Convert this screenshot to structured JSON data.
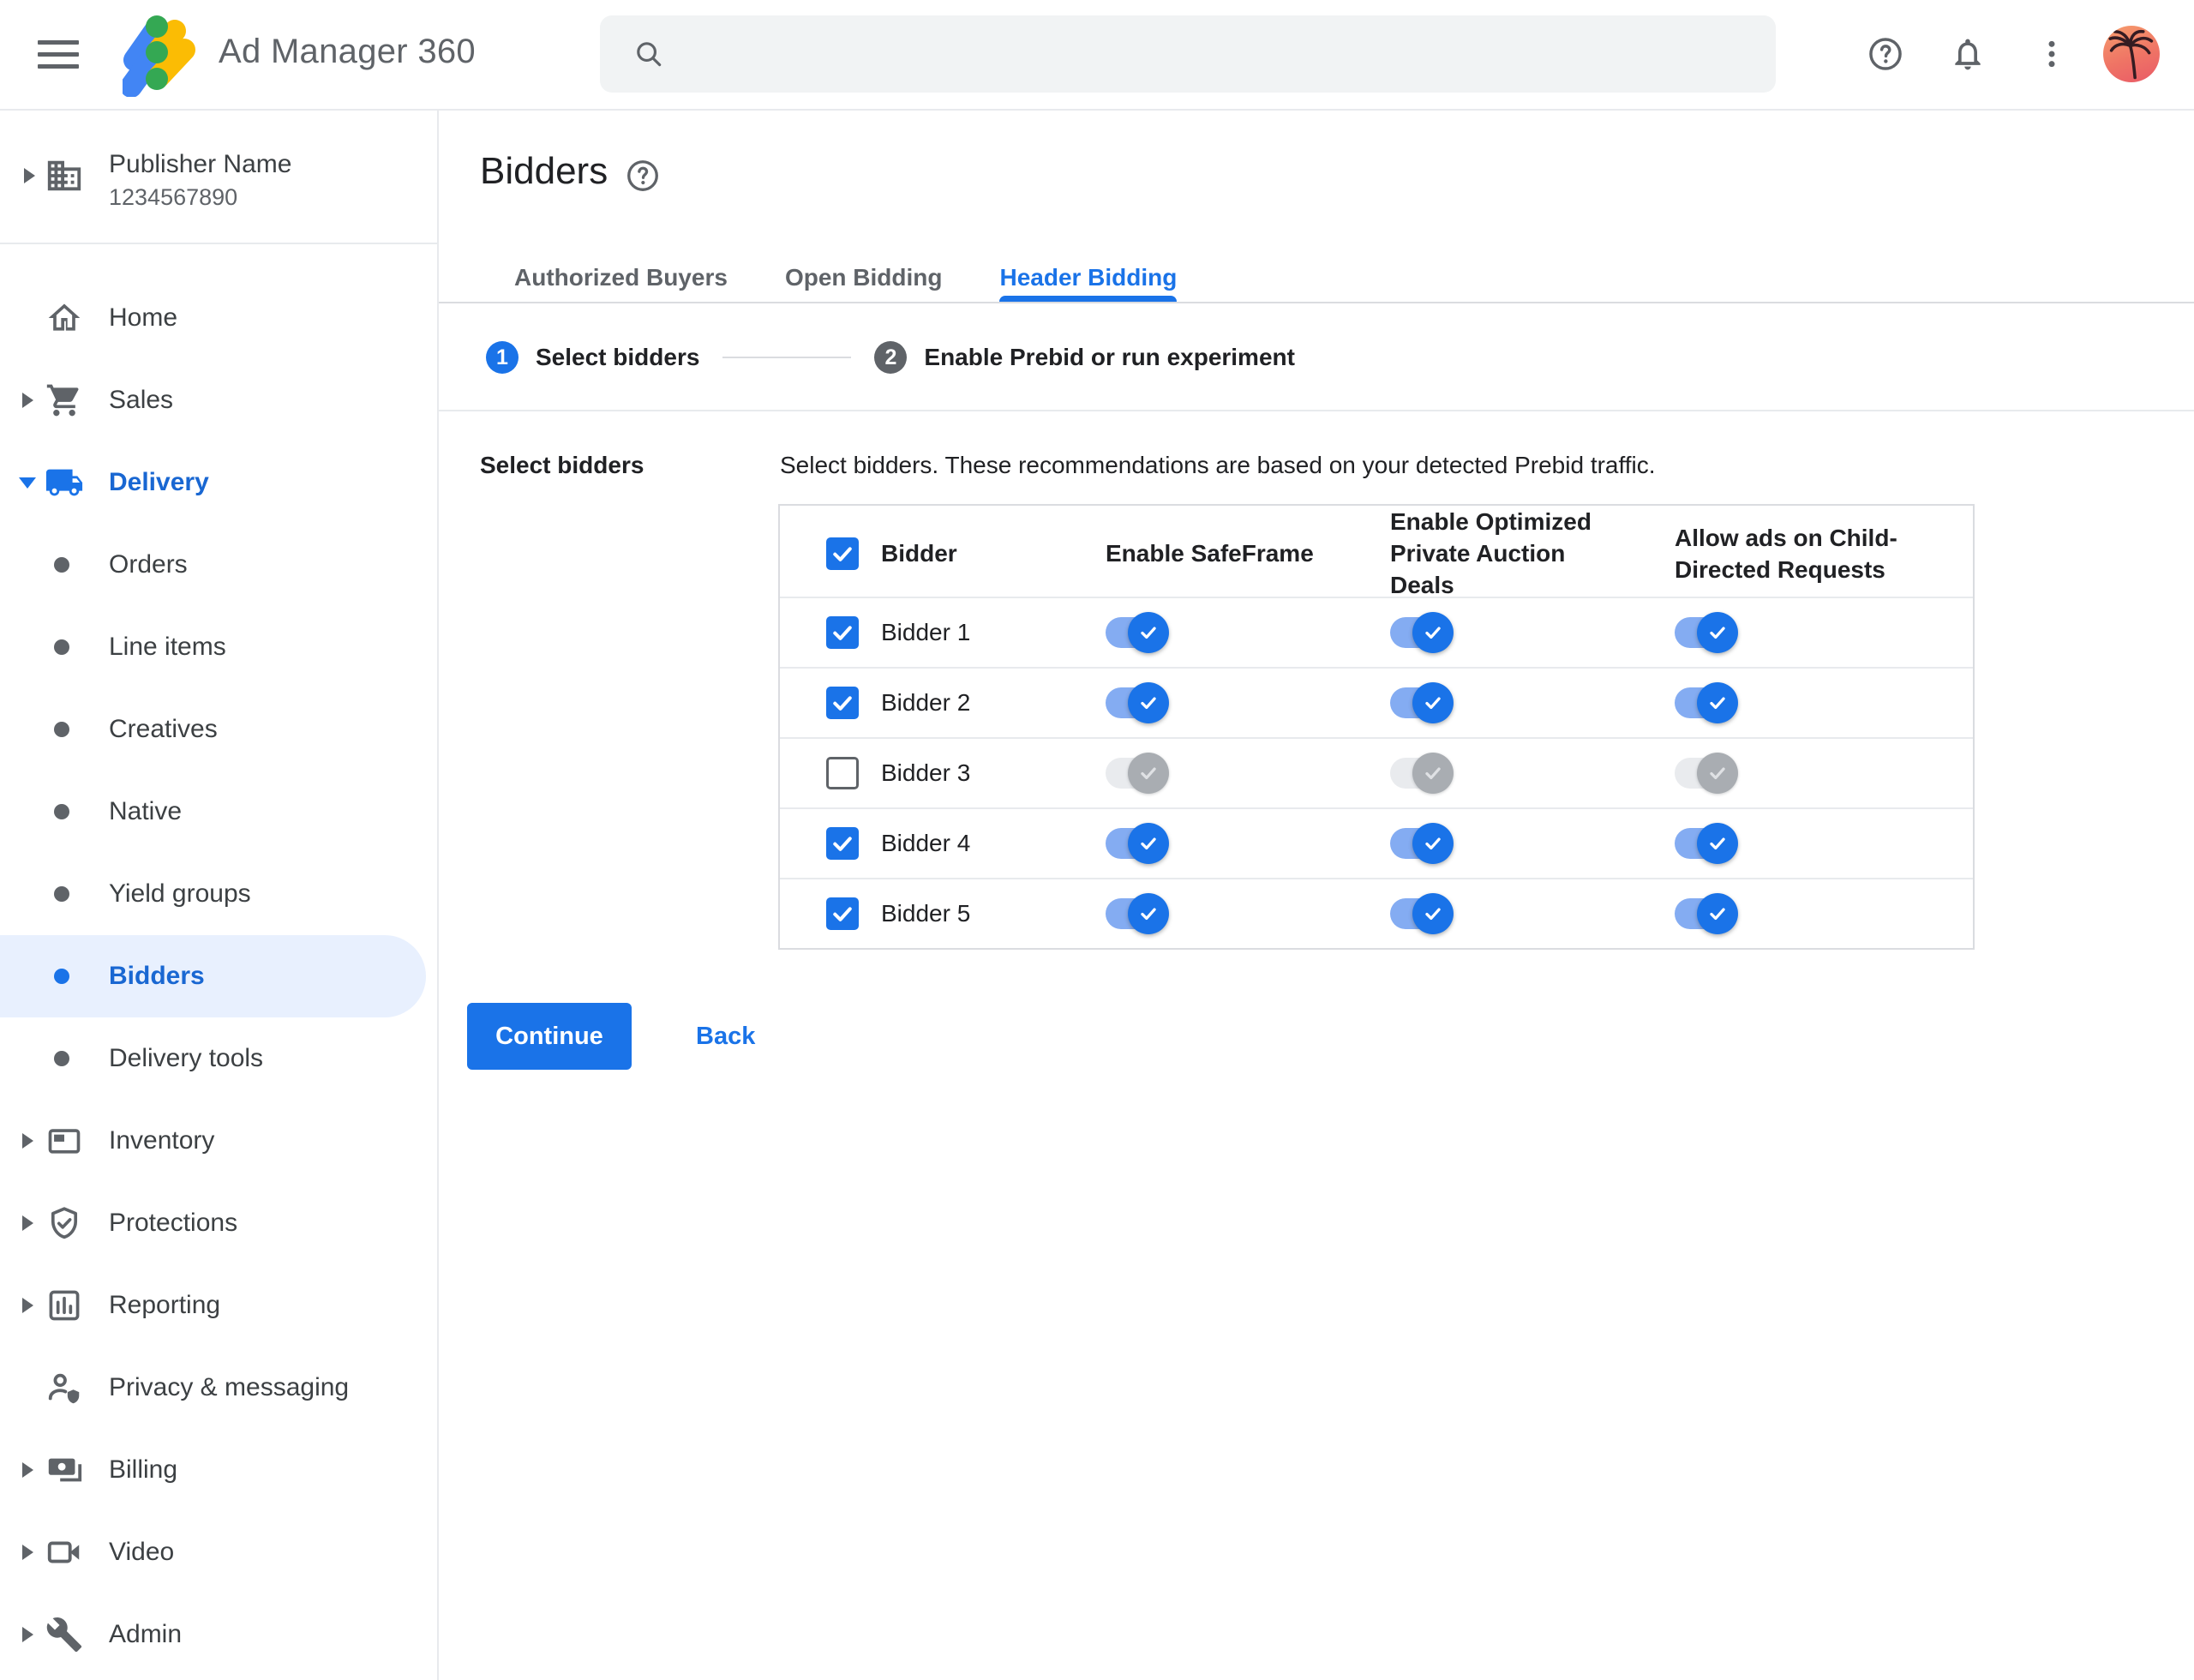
{
  "header": {
    "app_title": "Ad Manager 360",
    "search": {
      "value": "",
      "placeholder": ""
    },
    "icons": [
      "menu-icon",
      "ad-manager-logo",
      "search-icon",
      "help-icon",
      "notifications-icon",
      "more-vert-icon",
      "avatar"
    ]
  },
  "sidebar": {
    "publisher_name": "Publisher Name",
    "publisher_id": "1234567890",
    "items": [
      {
        "label": "Home",
        "icon": "home-icon",
        "level": "top",
        "expand": null,
        "active": false,
        "selected": false
      },
      {
        "label": "Sales",
        "icon": "cart-icon",
        "level": "top",
        "expand": "collapsed",
        "active": false,
        "selected": false
      },
      {
        "label": "Delivery",
        "icon": "truck-icon",
        "level": "top",
        "expand": "expanded",
        "active": true,
        "selected": false
      },
      {
        "label": "Orders",
        "icon": "bullet",
        "level": "sub",
        "expand": null,
        "active": false,
        "selected": false
      },
      {
        "label": "Line items",
        "icon": "bullet",
        "level": "sub",
        "expand": null,
        "active": false,
        "selected": false
      },
      {
        "label": "Creatives",
        "icon": "bullet",
        "level": "sub",
        "expand": null,
        "active": false,
        "selected": false
      },
      {
        "label": "Native",
        "icon": "bullet",
        "level": "sub",
        "expand": null,
        "active": false,
        "selected": false
      },
      {
        "label": "Yield groups",
        "icon": "bullet",
        "level": "sub",
        "expand": null,
        "active": false,
        "selected": false
      },
      {
        "label": "Bidders",
        "icon": "bullet",
        "level": "sub",
        "expand": null,
        "active": true,
        "selected": true
      },
      {
        "label": "Delivery tools",
        "icon": "bullet",
        "level": "sub",
        "expand": null,
        "active": false,
        "selected": false
      },
      {
        "label": "Inventory",
        "icon": "inventory-icon",
        "level": "top",
        "expand": "collapsed",
        "active": false,
        "selected": false
      },
      {
        "label": "Protections",
        "icon": "shield-check-icon",
        "level": "top",
        "expand": "collapsed",
        "active": false,
        "selected": false
      },
      {
        "label": "Reporting",
        "icon": "bar-chart-icon",
        "level": "top",
        "expand": "collapsed",
        "active": false,
        "selected": false
      },
      {
        "label": "Privacy & messaging",
        "icon": "person-shield-icon",
        "level": "top",
        "expand": null,
        "active": false,
        "selected": false
      },
      {
        "label": "Billing",
        "icon": "payments-icon",
        "level": "top",
        "expand": "collapsed",
        "active": false,
        "selected": false
      },
      {
        "label": "Video",
        "icon": "videocam-icon",
        "level": "top",
        "expand": "collapsed",
        "active": false,
        "selected": false
      },
      {
        "label": "Admin",
        "icon": "wrench-icon",
        "level": "top",
        "expand": "collapsed",
        "active": false,
        "selected": false
      }
    ]
  },
  "main": {
    "page_title": "Bidders",
    "tabs": [
      {
        "label": "Authorized Buyers",
        "active": false
      },
      {
        "label": "Open Bidding",
        "active": false
      },
      {
        "label": "Header Bidding",
        "active": true
      }
    ],
    "steps": [
      {
        "number": "1",
        "label": "Select bidders",
        "state": "active"
      },
      {
        "number": "2",
        "label": "Enable Prebid or run experiment",
        "state": "upcoming"
      }
    ],
    "section_label": "Select bidders",
    "description": "Select bidders. These recommendations are based on your detected Prebid traffic.",
    "table": {
      "header": {
        "select_all_checked": true,
        "bidder": "Bidder",
        "safeframe": "Enable SafeFrame",
        "optimized": "Enable Optimized Private Auction Deals",
        "child_directed": "Allow ads on Child-Directed Requests"
      },
      "rows": [
        {
          "name": "Bidder 1",
          "checked": true,
          "safeframe": true,
          "optimized": true,
          "child_directed": true
        },
        {
          "name": "Bidder 2",
          "checked": true,
          "safeframe": true,
          "optimized": true,
          "child_directed": true
        },
        {
          "name": "Bidder 3",
          "checked": false,
          "safeframe": false,
          "optimized": false,
          "child_directed": false
        },
        {
          "name": "Bidder 4",
          "checked": true,
          "safeframe": true,
          "optimized": true,
          "child_directed": true
        },
        {
          "name": "Bidder 5",
          "checked": true,
          "safeframe": true,
          "optimized": true,
          "child_directed": true
        }
      ]
    },
    "continue_label": "Continue",
    "back_label": "Back"
  },
  "colors": {
    "accent": "#1a73e8",
    "active_item_text": "#1967d2",
    "active_item_bg": "#e8f0fe",
    "toggle_track_on": "#84acf2",
    "toggle_thumb_on": "#1a73e8",
    "toggle_track_off": "#e9ebee",
    "toggle_thumb_off": "#a9adb2",
    "logo_blue": "#4285f4",
    "logo_yellow": "#fbbc04",
    "logo_green": "#34a853",
    "gray_icon": "#5f6368"
  }
}
